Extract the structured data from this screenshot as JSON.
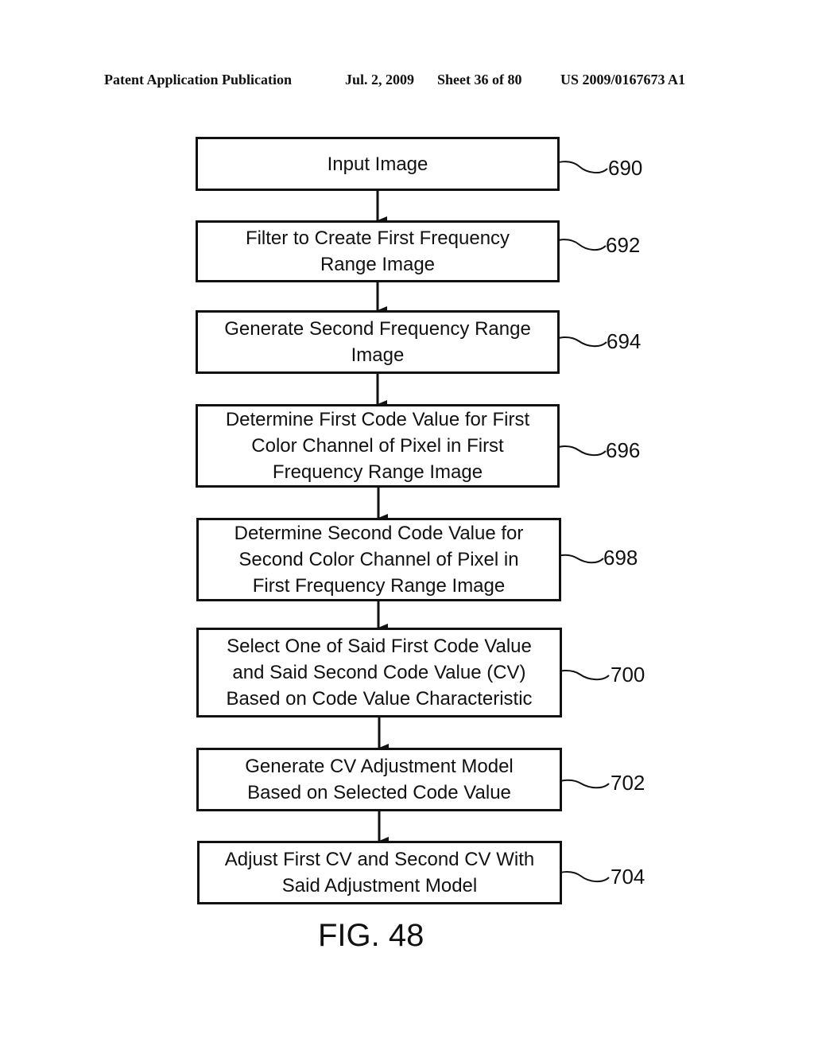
{
  "header": {
    "publication": "Patent Application Publication",
    "date": "Jul. 2, 2009",
    "sheet": "Sheet 36 of 80",
    "number": "US 2009/0167673 A1"
  },
  "steps": [
    {
      "text": "Input Image",
      "ref": "690"
    },
    {
      "text": "Filter to Create First Frequency\nRange Image",
      "ref": "692"
    },
    {
      "text": "Generate Second Frequency Range\nImage",
      "ref": "694"
    },
    {
      "text": "Determine First Code Value for First\nColor Channel of Pixel in First\nFrequency Range Image",
      "ref": "696"
    },
    {
      "text": "Determine Second Code Value for\nSecond Color Channel of Pixel in\nFirst Frequency Range Image",
      "ref": "698"
    },
    {
      "text": "Select One of Said First Code Value\nand Said Second Code Value (CV)\nBased on Code Value Characteristic",
      "ref": "700"
    },
    {
      "text": "Generate CV Adjustment Model\nBased on Selected Code Value",
      "ref": "702"
    },
    {
      "text": "Adjust First CV and Second CV With\nSaid Adjustment Model",
      "ref": "704"
    }
  ],
  "figure_label": "FIG. 48"
}
